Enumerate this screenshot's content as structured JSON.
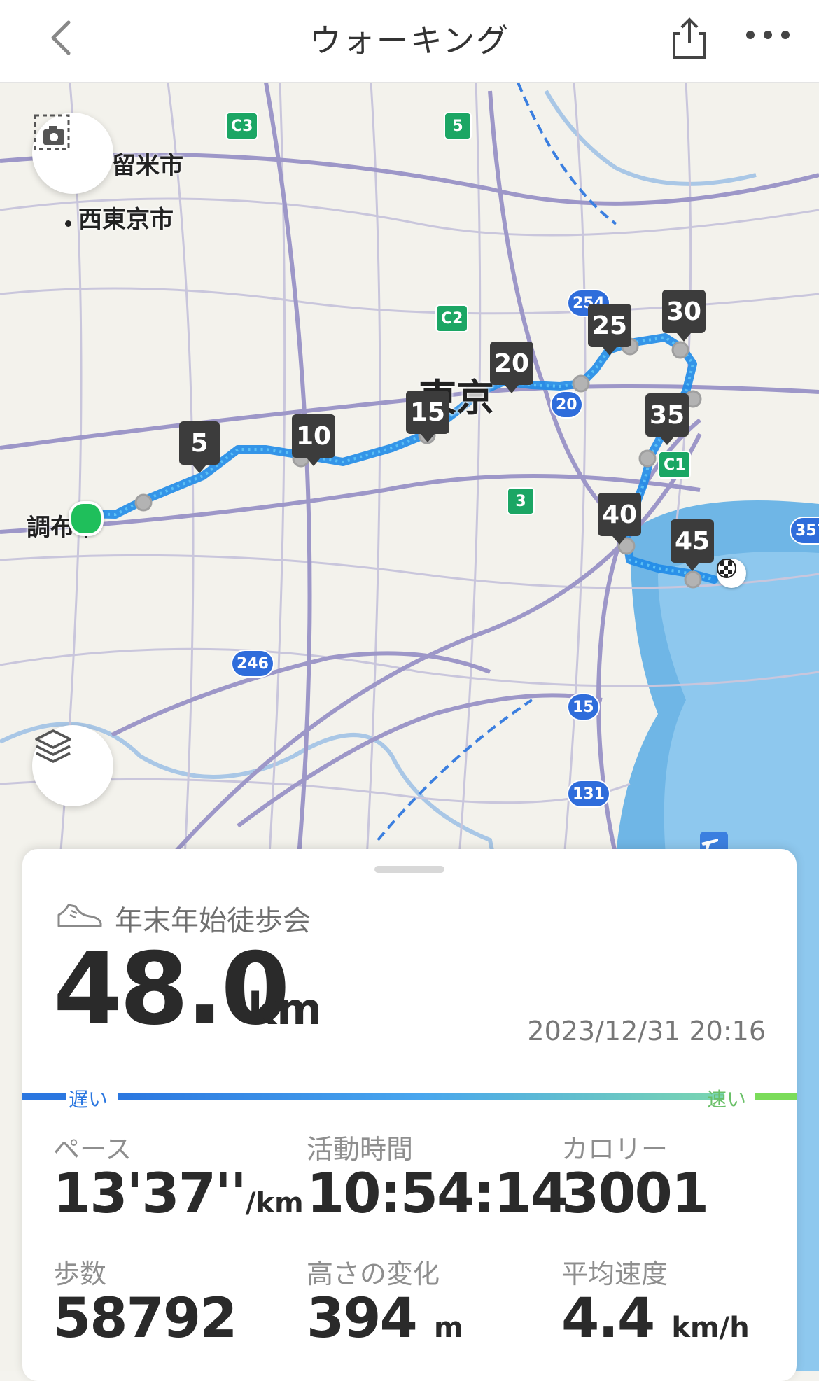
{
  "header": {
    "title": "ウォーキング"
  },
  "map": {
    "places": {
      "kurume": "留米市",
      "nishitokyo": "西東京市",
      "tokyo": "東京",
      "chofu": "調布市"
    },
    "road_badges": [
      "C3",
      "5",
      "C2",
      "254",
      "20",
      "3",
      "C1",
      "246",
      "15",
      "131",
      "357"
    ],
    "km_markers": [
      "5",
      "10",
      "15",
      "20",
      "25",
      "30",
      "35",
      "40",
      "45"
    ],
    "route_color": "#1f8be8",
    "start_color": "#1fbf5b"
  },
  "activity": {
    "name": "年末年始徒歩会",
    "distance": "48.0",
    "distance_unit": "km",
    "datetime": "2023/12/31 20:16",
    "pace_slow": "遅い",
    "pace_fast": "速い"
  },
  "stats": {
    "pace": {
      "label": "ペース",
      "value": "13'37''",
      "unit": "/km"
    },
    "duration": {
      "label": "活動時間",
      "value": "10:54:14"
    },
    "calories": {
      "label": "カロリー",
      "value": "3001"
    },
    "steps": {
      "label": "歩数",
      "value": "58792"
    },
    "elevation": {
      "label": "高さの変化",
      "value": "394",
      "unit": "m"
    },
    "avg_speed": {
      "label": "平均速度",
      "value": "4.4",
      "unit": "km/h"
    }
  }
}
